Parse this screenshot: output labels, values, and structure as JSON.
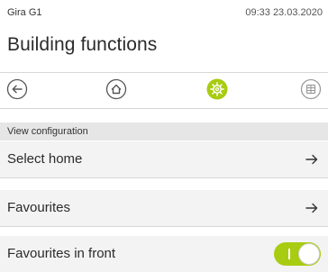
{
  "status": {
    "device": "Gira G1",
    "datetime": "09:33 23.03.2020"
  },
  "header": {
    "title": "Building functions"
  },
  "nav": [
    {
      "icon": "back-arrow-icon",
      "active": false
    },
    {
      "icon": "home-icon",
      "active": false
    },
    {
      "icon": "settings-gear-icon",
      "active": true
    },
    {
      "icon": "grid-icon",
      "active": false
    }
  ],
  "colors": {
    "accent": "#a8cc12",
    "row_bg": "#f3f3f3",
    "section_bg": "#e6e6e6"
  },
  "section": {
    "title": "View configuration"
  },
  "rows": [
    {
      "label": "Select home",
      "control": "arrow"
    },
    {
      "label": "Favourites",
      "control": "arrow"
    },
    {
      "label": "Favourites in front",
      "control": "toggle",
      "value": true
    }
  ]
}
